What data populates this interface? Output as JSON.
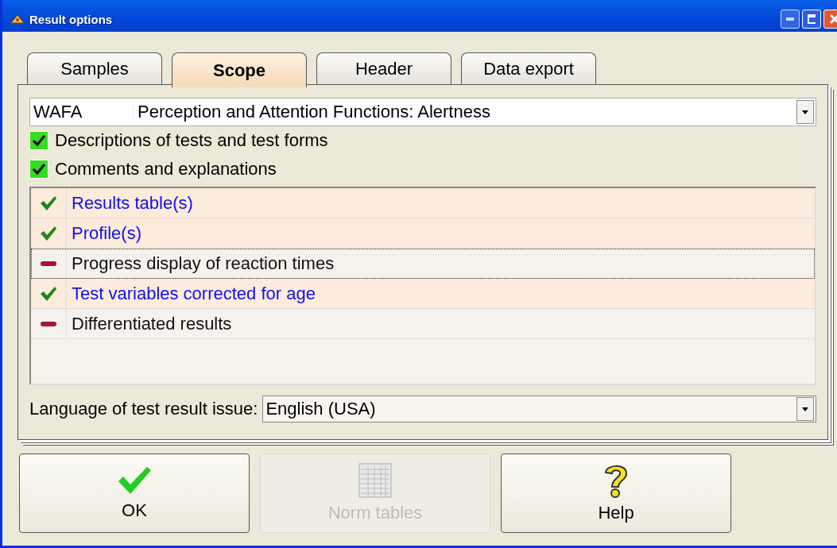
{
  "window": {
    "title": "Result options"
  },
  "tabs": [
    {
      "label": "Samples",
      "selected": false
    },
    {
      "label": "Scope",
      "selected": true
    },
    {
      "label": "Header",
      "selected": false
    },
    {
      "label": "Data export",
      "selected": false
    }
  ],
  "test_select": {
    "code": "WAFA",
    "name": "Perception and Attention Functions: Alertness"
  },
  "options": [
    {
      "label": "Descriptions of tests and test forms",
      "checked": true
    },
    {
      "label": "Comments and explanations",
      "checked": true
    }
  ],
  "sections": [
    {
      "label": "Results table(s)",
      "included": true,
      "focused": false
    },
    {
      "label": "Profile(s)",
      "included": true,
      "focused": false
    },
    {
      "label": "Progress display of reaction times",
      "included": false,
      "focused": true
    },
    {
      "label": "Test variables corrected for age",
      "included": true,
      "focused": false
    },
    {
      "label": "Differentiated results",
      "included": false,
      "focused": false
    }
  ],
  "language": {
    "label": "Language of test result issue:",
    "value": "English (USA)"
  },
  "buttons": [
    {
      "kind": "ok",
      "label": "OK",
      "disabled": false
    },
    {
      "kind": "table",
      "label": "Norm tables",
      "disabled": true
    },
    {
      "kind": "help",
      "label": "Help",
      "disabled": false
    }
  ]
}
